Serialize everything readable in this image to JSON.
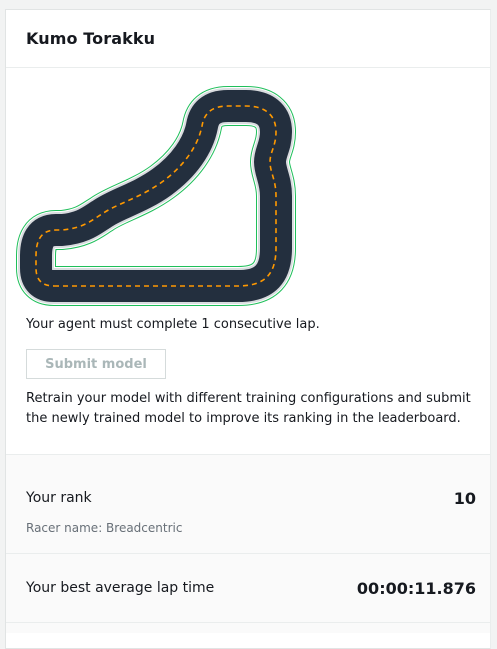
{
  "card": {
    "title": "Kumo Torakku"
  },
  "track": {
    "colors": {
      "asphalt": "#232f3e",
      "center_line": "#ff9900",
      "edge_line": "#ffffff",
      "grass_outline": "#1fbf5a"
    }
  },
  "requirement_text": "Your agent must complete 1 consecutive lap.",
  "submit_button": {
    "label": "Submit model",
    "disabled": true
  },
  "retrain_text": "Retrain your model with different training configurations and submit the newly trained model to improve its ranking in the leaderboard.",
  "rank": {
    "label": "Your rank",
    "value": "10",
    "racer_name": "Racer name: Breadcentric"
  },
  "lap_time": {
    "label": "Your best average lap time",
    "value": "00:00:11.876"
  }
}
